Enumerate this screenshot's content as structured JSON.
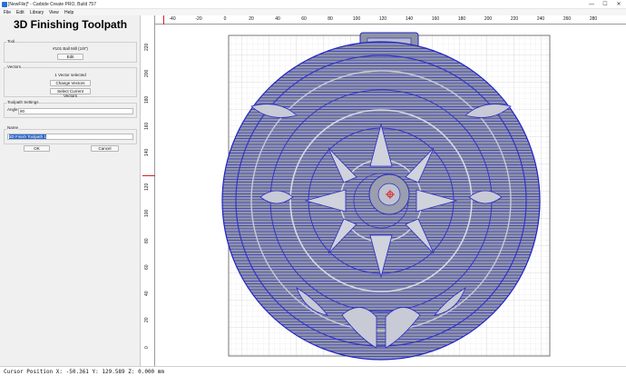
{
  "window": {
    "title": "[NewFile]* - Carbide Create PRO, Build 757",
    "minimize": "—",
    "maximize": "☐",
    "close": "✕"
  },
  "menu": [
    "File",
    "Edit",
    "Library",
    "View",
    "Help"
  ],
  "panel": {
    "heading": "3D Finishing Toolpath",
    "tool": {
      "label": "Tool",
      "name": "#101 Ball Mill (1/8\")",
      "edit_button": "Edit"
    },
    "vectors": {
      "label": "Vectors",
      "status": "1 Vector selected",
      "change_button": "Change Vectors",
      "select_button": "Select Current Vectors"
    },
    "settings": {
      "label": "Toolpath Settings",
      "angle_label": "Angle",
      "angle_value": "90"
    },
    "name": {
      "label": "Name",
      "value": "3D Finish Toolpath 1"
    },
    "ok_button": "OK",
    "cancel_button": "Cancel"
  },
  "ruler": {
    "x_ticks": [
      "-40",
      "-20",
      "0",
      "20",
      "40",
      "60",
      "80",
      "100",
      "120",
      "140",
      "160",
      "180",
      "200",
      "220",
      "240",
      "260",
      "280"
    ],
    "y_ticks": [
      "220",
      "200",
      "180",
      "160",
      "140",
      "120",
      "100",
      "80",
      "60",
      "40",
      "20",
      "0"
    ]
  },
  "status": {
    "text": "Cursor Position X: -50.361 Y: 129.589 Z: 0.000 mm"
  },
  "colors": {
    "toolpath": "#1f22c8",
    "model_fill": "#8e93a3",
    "grid": "#d6d6d6",
    "stock_border": "#555555",
    "selection": "#2a66cc",
    "cursor_marker": "#cc2222"
  },
  "icons": {
    "app": "carbide-create-icon",
    "origin": "origin-crosshair-icon"
  }
}
